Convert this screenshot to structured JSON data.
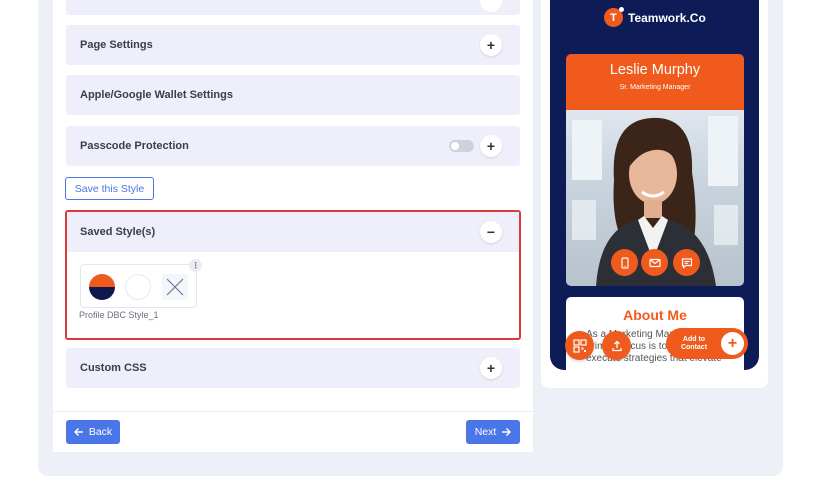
{
  "accordion": {
    "page_settings": "Page Settings",
    "wallet_settings": "Apple/Google Wallet Settings",
    "passcode_protection": "Passcode Protection",
    "custom_css": "Custom CSS",
    "expand_symbol": "+",
    "collapse_symbol": "−"
  },
  "save_style_label": "Save this Style",
  "saved_styles": {
    "title": "Saved Style(s)",
    "style_name": "Profile DBC Style_1",
    "colors": {
      "primary": "#f05a1c",
      "secondary": "#10184d",
      "accent": "#ffffff"
    }
  },
  "navigation": {
    "back_label": "Back",
    "next_label": "Next"
  },
  "preview": {
    "brand_initial": "T",
    "brand_name": "Teamwork.Co",
    "person_name": "Leslie Murphy",
    "person_title": "Sr. Marketing Manager",
    "about_title": "About Me",
    "about_text": "As a Marketing Manager, my primary focus is to develop and execute strategies that elevate",
    "add_to_contact": "Add to Contact",
    "add_symbol": "+"
  },
  "icons": [
    "chevron-up-icon",
    "plus-icon",
    "minus-icon",
    "close-icon",
    "more-dots-icon",
    "arrow-left-icon",
    "arrow-right-icon",
    "phone-icon",
    "mail-icon",
    "chat-icon",
    "qr-icon",
    "share-icon"
  ]
}
